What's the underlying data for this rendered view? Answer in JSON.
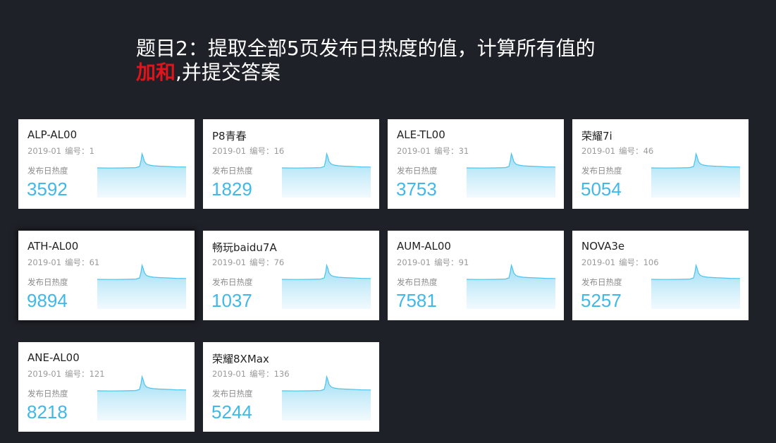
{
  "title": {
    "line1": "题目2：提取全部5页发布日热度的值，计算所有值的",
    "highlight": "加和",
    "line2_rest": ",并提交答案"
  },
  "colors": {
    "background": "#1f2128",
    "card": "#ffffff",
    "value": "#40b8e8",
    "highlight": "#e0141b"
  },
  "cards": [
    {
      "name": "ALP-AL00",
      "date": "2019-01",
      "id_label": "编号：",
      "id": "1",
      "metric_label": "发布日热度",
      "value": "3592"
    },
    {
      "name": "P8青春",
      "date": "2019-01",
      "id_label": "编号：",
      "id": "16",
      "metric_label": "发布日热度",
      "value": "1829"
    },
    {
      "name": "ALE-TL00",
      "date": "2019-01",
      "id_label": "编号：",
      "id": "31",
      "metric_label": "发布日热度",
      "value": "3753"
    },
    {
      "name": "荣耀7i",
      "date": "2019-01",
      "id_label": "编号：",
      "id": "46",
      "metric_label": "发布日热度",
      "value": "5054"
    },
    {
      "name": "ATH-AL00",
      "date": "2019-01",
      "id_label": "编号：",
      "id": "61",
      "metric_label": "发布日热度",
      "value": "9894"
    },
    {
      "name": "畅玩baidu7A",
      "date": "2019-01",
      "id_label": "编号：",
      "id": "76",
      "metric_label": "发布日热度",
      "value": "1037"
    },
    {
      "name": "AUM-AL00",
      "date": "2019-01",
      "id_label": "编号：",
      "id": "91",
      "metric_label": "发布日热度",
      "value": "7581"
    },
    {
      "name": "NOVA3e",
      "date": "2019-01",
      "id_label": "编号：",
      "id": "106",
      "metric_label": "发布日热度",
      "value": "5257"
    },
    {
      "name": "ANE-AL00",
      "date": "2019-01",
      "id_label": "编号：",
      "id": "121",
      "metric_label": "发布日热度",
      "value": "8218"
    },
    {
      "name": "荣耀8XMax",
      "date": "2019-01",
      "id_label": "编号：",
      "id": "136",
      "metric_label": "发布日热度",
      "value": "5244"
    }
  ]
}
